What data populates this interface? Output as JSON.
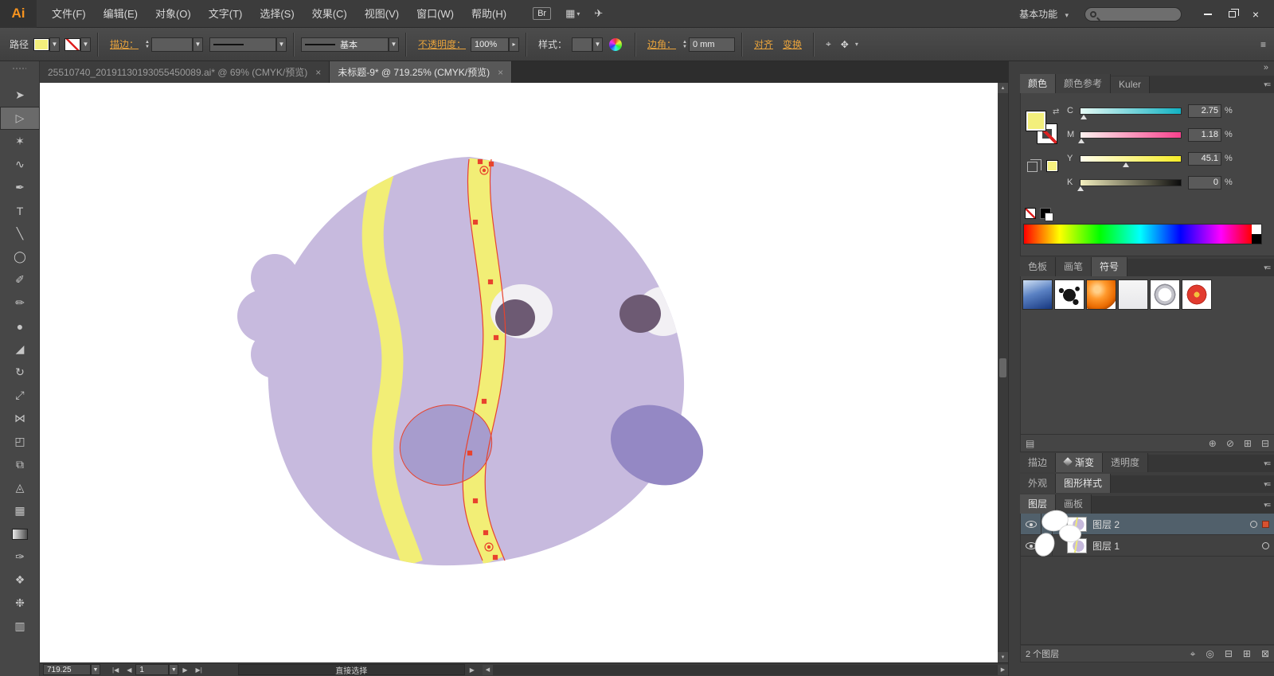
{
  "window": {
    "logo_text": "Ai",
    "menu_items": [
      "文件(F)",
      "编辑(E)",
      "对象(O)",
      "文字(T)",
      "选择(S)",
      "效果(C)",
      "视图(V)",
      "窗口(W)",
      "帮助(H)"
    ],
    "br_button": "Br",
    "workspace_switcher": "基本功能"
  },
  "icons": {
    "caret_down": "▾",
    "dropdown": "▼",
    "arrange": "▦",
    "cs_live": "✈",
    "close": "×",
    "spinner_up": "▲",
    "spinner_down": "▼",
    "prev": "◀",
    "next": "▶",
    "first": "|◀",
    "last": "▶|",
    "panel_menu": "▾≡",
    "collapse": "»",
    "target": "○",
    "expand": "▶",
    "slider_popup": "▸",
    "menu_lines": "≡",
    "swap": "⇄",
    "crosshair": "⌖",
    "transform_tool": "✥",
    "locate": "⌖",
    "clip_mask": "◎",
    "new_sublayer": "⊟",
    "new_layer": "⊞",
    "delete": "⊠",
    "sym_libraries": "▤",
    "sym_place": "⊕",
    "sym_break": "⊘",
    "sym_new": "⊞",
    "sym_delete": "⊟"
  },
  "control_bar": {
    "context_label": "路径",
    "stroke_label": "描边：",
    "brush_name": "基本",
    "opacity_label": "不透明度：",
    "opacity_value": "100%",
    "style_label": "样式：",
    "corner_label": "边角：",
    "corner_value": "0 mm",
    "align_label": "对齐",
    "transform_label": "变换"
  },
  "document_tabs": {
    "tab1": "25510740_20191130193055450089.ai* @ 69% (CMYK/预览)",
    "tab2": "未标题-9* @ 719.25% (CMYK/预览)",
    "close_glyph": "×"
  },
  "toolbar": {
    "tools": [
      {
        "name": "selection-tool",
        "glyph": "➤"
      },
      {
        "name": "direct-selection-tool",
        "glyph": "▷",
        "active": true
      },
      {
        "name": "magic-wand-tool",
        "glyph": "✶"
      },
      {
        "name": "lasso-tool",
        "glyph": "∿"
      },
      {
        "name": "pen-tool",
        "glyph": "✒"
      },
      {
        "name": "type-tool",
        "glyph": "T"
      },
      {
        "name": "line-segment-tool",
        "glyph": "╲"
      },
      {
        "name": "ellipse-tool",
        "glyph": "◯"
      },
      {
        "name": "paintbrush-tool",
        "glyph": "✐"
      },
      {
        "name": "pencil-tool",
        "glyph": "✏"
      },
      {
        "name": "blob-brush-tool",
        "glyph": "●"
      },
      {
        "name": "eraser-tool",
        "glyph": "◢"
      },
      {
        "name": "rotate-tool",
        "glyph": "↻"
      },
      {
        "name": "scale-tool",
        "glyph": "⤢"
      },
      {
        "name": "width-tool",
        "glyph": "⋈"
      },
      {
        "name": "free-transform-tool",
        "glyph": "◰"
      },
      {
        "name": "shape-builder-tool",
        "glyph": "⧉"
      },
      {
        "name": "perspective-grid-tool",
        "glyph": "◬"
      },
      {
        "name": "mesh-tool",
        "glyph": "▦"
      },
      {
        "name": "gradient-tool",
        "glyph": ""
      },
      {
        "name": "eyedropper-tool",
        "glyph": "✑"
      },
      {
        "name": "blend-tool",
        "glyph": "❖"
      },
      {
        "name": "symbol-sprayer-tool",
        "glyph": "❉"
      },
      {
        "name": "column-graph-tool",
        "glyph": "▥"
      }
    ]
  },
  "canvas": {
    "fish": {
      "body_color": "#c7bade",
      "fin_center_color": "#a79ccd",
      "fin_right_color": "#9488c4",
      "stripe_color": "#f2ee76",
      "eye_white": "#f2f0f4",
      "pupil_color": "#6d5a73",
      "selection_color": "#e8432d"
    }
  },
  "dock": {
    "color_panel": {
      "tabs": [
        "颜色",
        "颜色参考",
        "Kuler"
      ],
      "sliders": [
        {
          "channel": "C",
          "value": "2.75",
          "unit": "%"
        },
        {
          "channel": "M",
          "value": "1.18",
          "unit": "%"
        },
        {
          "channel": "Y",
          "value": "45.1",
          "unit": "%"
        },
        {
          "channel": "K",
          "value": "0",
          "unit": "%"
        }
      ]
    },
    "symbols_panel": {
      "tabs": [
        "色板",
        "画笔",
        "符号"
      ],
      "items": [
        "gradient-symbol",
        "ink-splat-symbol",
        "orange-sphere-symbol",
        "blank-symbol",
        "ring-symbol",
        "flower-symbol"
      ]
    },
    "collapsed_group1": [
      "描边",
      "渐变",
      "透明度"
    ],
    "collapsed_group2": [
      "外观",
      "图形样式"
    ],
    "layers_panel": {
      "tabs": [
        "图层",
        "画板"
      ],
      "layers": [
        {
          "name": "图层 2",
          "selected": true
        },
        {
          "name": "图层 1",
          "selected": false
        }
      ],
      "layer_count": "2 个图层"
    }
  },
  "status_bar": {
    "zoom_value": "719.25",
    "artboard_number": "1",
    "tool_name": "直接选择"
  }
}
